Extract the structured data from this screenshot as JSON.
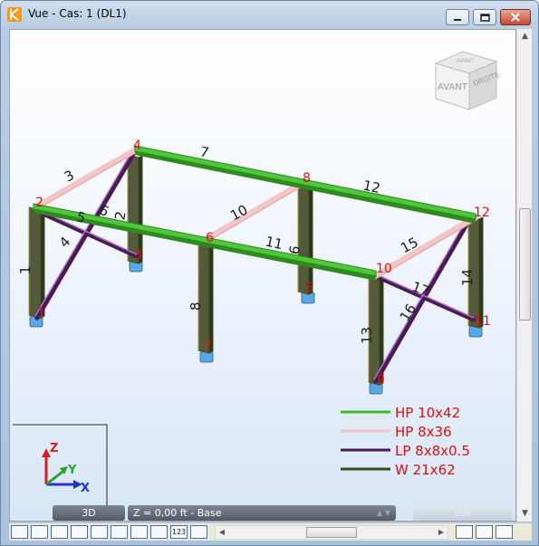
{
  "window": {
    "title": "Vue - Cas: 1 (DL1)"
  },
  "view_cube": {
    "front_label": "AVANT",
    "right_label": "DROITE",
    "top_label": "AVANT"
  },
  "axis": {
    "z": "Z",
    "y": "Y",
    "x": "X"
  },
  "status": {
    "mode": "3D",
    "level": "Z = 0,00 ft - Base",
    "vue": "Vue"
  },
  "legend": [
    {
      "label": "HP 10x42",
      "color": "#3cba2a"
    },
    {
      "label": "HP 8x36",
      "color": "#f4c4c4"
    },
    {
      "label": "LP 8x8x0.5",
      "color": "#4a1a55"
    },
    {
      "label": "W 21x62",
      "color": "#3a4a18"
    }
  ],
  "node_labels": [
    {
      "id": "1"
    },
    {
      "id": "2"
    },
    {
      "id": "3"
    },
    {
      "id": "4"
    },
    {
      "id": "5"
    },
    {
      "id": "6"
    },
    {
      "id": "7"
    },
    {
      "id": "8"
    },
    {
      "id": "9"
    },
    {
      "id": "10"
    },
    {
      "id": "11"
    },
    {
      "id": "12"
    }
  ],
  "member_labels": [
    "1",
    "2",
    "3",
    "4",
    "5",
    "6",
    "7",
    "8",
    "9",
    "10",
    "11",
    "12",
    "13",
    "14",
    "15",
    "16",
    "17"
  ],
  "toolbar": {
    "buttons": [
      "",
      "",
      "",
      "",
      "",
      "",
      "",
      "",
      "",
      "123"
    ]
  }
}
